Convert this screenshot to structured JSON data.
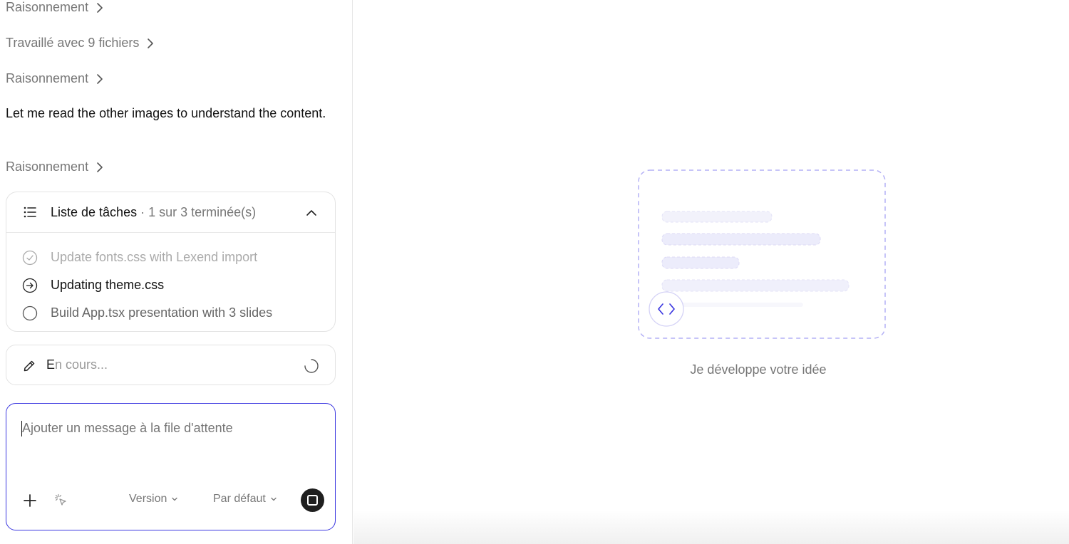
{
  "conversation": {
    "steps": [
      {
        "label": "Raisonnement"
      },
      {
        "label": "Travaillé avec 9 fichiers"
      },
      {
        "label": "Raisonnement"
      }
    ],
    "message": "Let me read the other images to understand the content.",
    "steps_after": [
      {
        "label": "Raisonnement"
      }
    ]
  },
  "tasks": {
    "title": "Liste de tâches",
    "separator": "·",
    "progress": "1 sur 3 terminée(s)",
    "items": [
      {
        "label": "Update fonts.css with Lexend import",
        "state": "done",
        "icon": "check-circle-icon"
      },
      {
        "label": "Updating theme.css",
        "state": "active",
        "icon": "arrow-circle-icon"
      },
      {
        "label": "Build App.tsx presentation with 3 slides",
        "state": "pending",
        "icon": "empty-circle-icon"
      }
    ]
  },
  "status": {
    "first_letter": "E",
    "rest": "n cours...",
    "icon": "pencil-icon"
  },
  "composer": {
    "placeholder": "Ajouter un message à la file d'attente",
    "version_label": "Version",
    "mode_label": "Par défaut"
  },
  "preview": {
    "caption": "Je développe votre idée",
    "accent_color": "#6b66f0",
    "icon": "code-icon"
  }
}
